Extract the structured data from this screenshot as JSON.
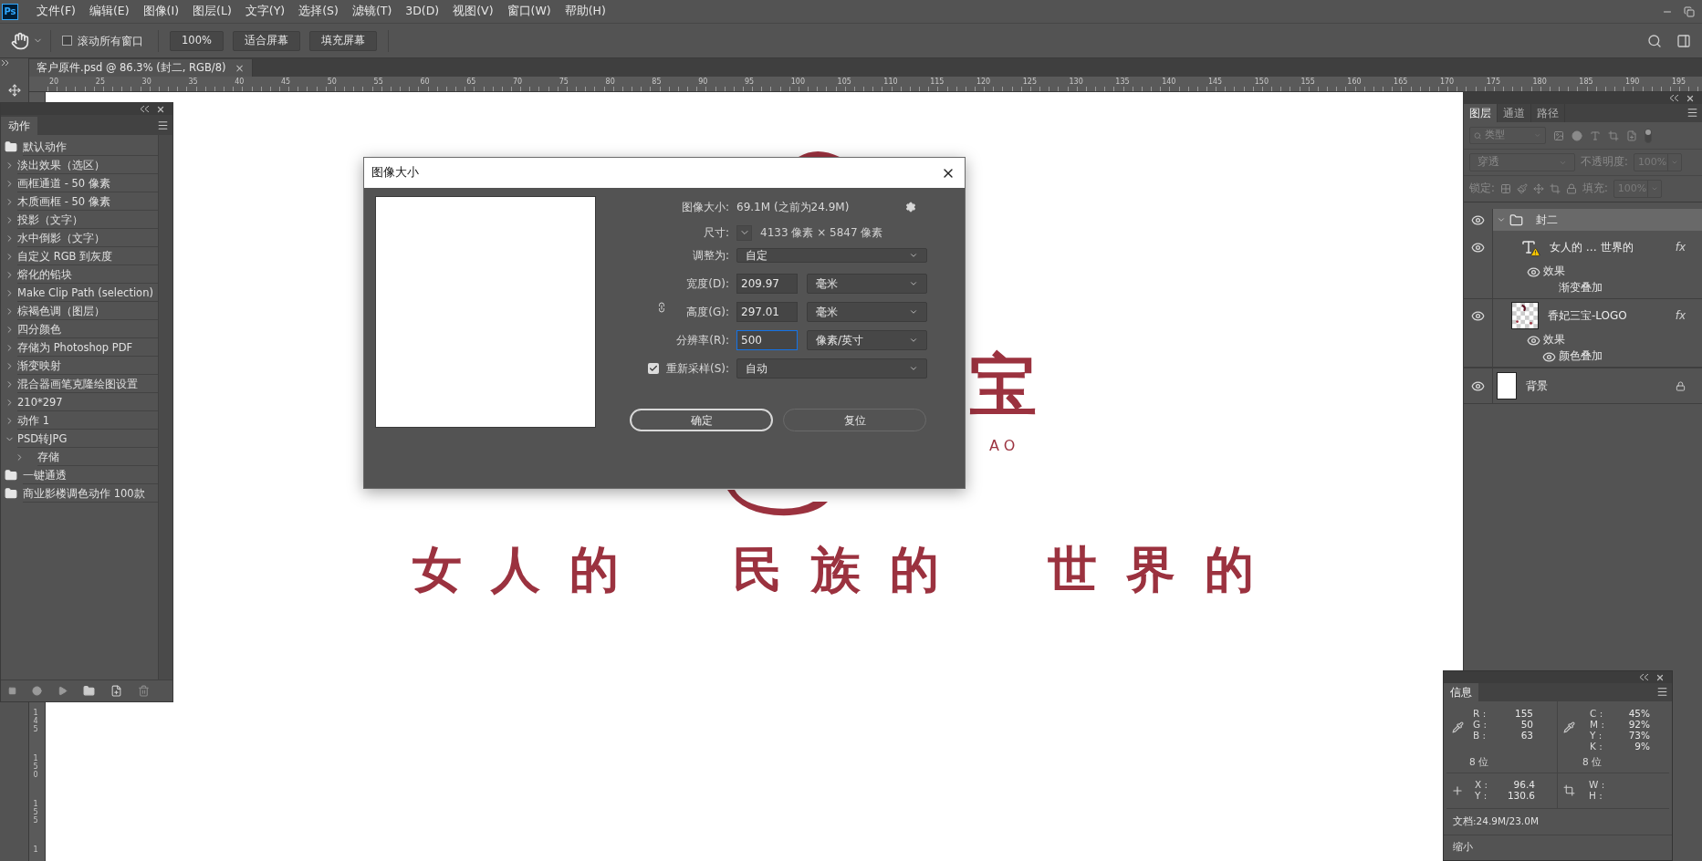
{
  "menu": {
    "logo": "Ps",
    "items": [
      "文件(F)",
      "编辑(E)",
      "图像(I)",
      "图层(L)",
      "文字(Y)",
      "选择(S)",
      "滤镜(T)",
      "3D(D)",
      "视图(V)",
      "窗口(W)",
      "帮助(H)"
    ]
  },
  "options_bar": {
    "scroll_all": {
      "label": "滚动所有窗口",
      "checked": false
    },
    "buttons": [
      "100%",
      "适合屏幕",
      "填充屏幕"
    ]
  },
  "document_tab": {
    "title": "客户原件.psd @ 86.3% (封二, RGB/8)",
    "close": "×"
  },
  "rulers": {
    "horizontal": [
      "20",
      "25",
      "30",
      "35",
      "40",
      "45",
      "50",
      "55",
      "60",
      "65",
      "70",
      "75",
      "80",
      "85",
      "90",
      "95",
      "100",
      "105",
      "110",
      "115",
      "120",
      "125",
      "130",
      "135",
      "140",
      "145",
      "150",
      "155",
      "160",
      "165",
      "170",
      "175",
      "180",
      "185",
      "190",
      "195"
    ],
    "vertical": [
      "145",
      "150",
      "155",
      "1"
    ]
  },
  "canvas": {
    "logo_glyph": "宝",
    "logo_latin": "AO",
    "slogans": [
      [
        "女",
        "人",
        "的"
      ],
      [
        "民",
        "族",
        "的"
      ],
      [
        "世",
        "界",
        "的"
      ]
    ]
  },
  "actions_panel": {
    "tab": "动作",
    "sets": [
      {
        "name": "默认动作",
        "actions": [
          {
            "name": "淡出效果（选区）",
            "expanded": false
          },
          {
            "name": "画框通道 - 50 像素",
            "expanded": false
          },
          {
            "name": "木质画框 - 50 像素",
            "expanded": false
          },
          {
            "name": "投影（文字）",
            "expanded": false
          },
          {
            "name": "水中倒影（文字）",
            "expanded": false
          },
          {
            "name": "自定义 RGB 到灰度",
            "expanded": false
          },
          {
            "name": "熔化的铅块",
            "expanded": false
          },
          {
            "name": "Make Clip Path (selection)",
            "expanded": false
          },
          {
            "name": "棕褐色调（图层）",
            "expanded": false
          },
          {
            "name": "四分颜色",
            "expanded": false
          },
          {
            "name": "存储为 Photoshop PDF",
            "expanded": false
          },
          {
            "name": "渐变映射",
            "expanded": false
          },
          {
            "name": "混合器画笔克隆绘图设置",
            "expanded": false
          },
          {
            "name": "210*297",
            "expanded": false
          },
          {
            "name": "动作 1",
            "expanded": false
          },
          {
            "name": "PSD转JPG",
            "expanded": true,
            "children": [
              {
                "name": "存储",
                "expanded": false
              }
            ]
          }
        ]
      },
      {
        "name": "一键通透"
      },
      {
        "name": "商业影楼调色动作 100款"
      }
    ]
  },
  "layers_panel": {
    "tabs": [
      {
        "label": "图层",
        "selected": true
      },
      {
        "label": "通道",
        "selected": false
      },
      {
        "label": "路径",
        "selected": false
      }
    ],
    "filter": {
      "placeholder": "类型"
    },
    "blend_mode": "穿透",
    "opacity": {
      "label": "不透明度:",
      "value": "100%"
    },
    "lock_label": "锁定:",
    "fill": {
      "label": "填充:",
      "value": "100%"
    },
    "layers": [
      {
        "kind": "group",
        "name": "封二",
        "visible": true,
        "selected": true,
        "expanded": true,
        "children": [
          {
            "kind": "text",
            "name": "女人的 … 世界的",
            "visible": true,
            "selected": false,
            "warning": true,
            "fx": "fx",
            "effects_label": "效果",
            "effects_visible": true,
            "effects": [
              {
                "name": "渐变叠加",
                "visible": false
              }
            ]
          },
          {
            "kind": "image",
            "name": "香妃三宝-LOGO",
            "visible": true,
            "selected": false,
            "fx": "fx",
            "effects_label": "效果",
            "effects_visible": true,
            "effects": [
              {
                "name": "颜色叠加",
                "visible": true
              }
            ]
          }
        ]
      },
      {
        "kind": "background",
        "name": "背景",
        "visible": true,
        "selected": false,
        "locked": true
      }
    ]
  },
  "info_panel": {
    "tab": "信息",
    "rgb": [
      {
        "label": "R :",
        "value": "155"
      },
      {
        "label": "G :",
        "value": "50"
      },
      {
        "label": "B :",
        "value": "63"
      }
    ],
    "rgb_depth": "8 位",
    "cmyk": [
      {
        "label": "C :",
        "value": "45%"
      },
      {
        "label": "M :",
        "value": "92%"
      },
      {
        "label": "Y :",
        "value": "73%"
      },
      {
        "label": "K :",
        "value": "9%"
      }
    ],
    "cmyk_depth": "8 位",
    "position": [
      {
        "label": "X :",
        "value": "96.4"
      },
      {
        "label": "Y :",
        "value": "130.6"
      }
    ],
    "size": [
      {
        "label": "W :"
      },
      {
        "label": "H :"
      }
    ],
    "document": "文档:24.9M/23.0M",
    "footer": "缩小"
  },
  "dialog": {
    "title": "图像大小",
    "size_label": "图像大小:",
    "size_value": "69.1M (之前为24.9M)",
    "dims_label": "尺寸:",
    "dims_value": "4133 像素 × 5847 像素",
    "fit_label": "调整为:",
    "fit_value": "自定",
    "fields": [
      {
        "label": "宽度(D):",
        "value": "209.97",
        "unit": "毫米",
        "focused": false
      },
      {
        "label": "高度(G):",
        "value": "297.01",
        "unit": "毫米",
        "focused": false
      },
      {
        "label": "分辨率(R):",
        "value": "500",
        "unit": "像素/英寸",
        "focused": true
      }
    ],
    "linked": true,
    "resample": {
      "label": "重新采样(S):",
      "checked": true,
      "value": "自动"
    },
    "buttons": [
      {
        "label": "确定",
        "default": true
      },
      {
        "label": "复位",
        "default": false
      }
    ]
  }
}
